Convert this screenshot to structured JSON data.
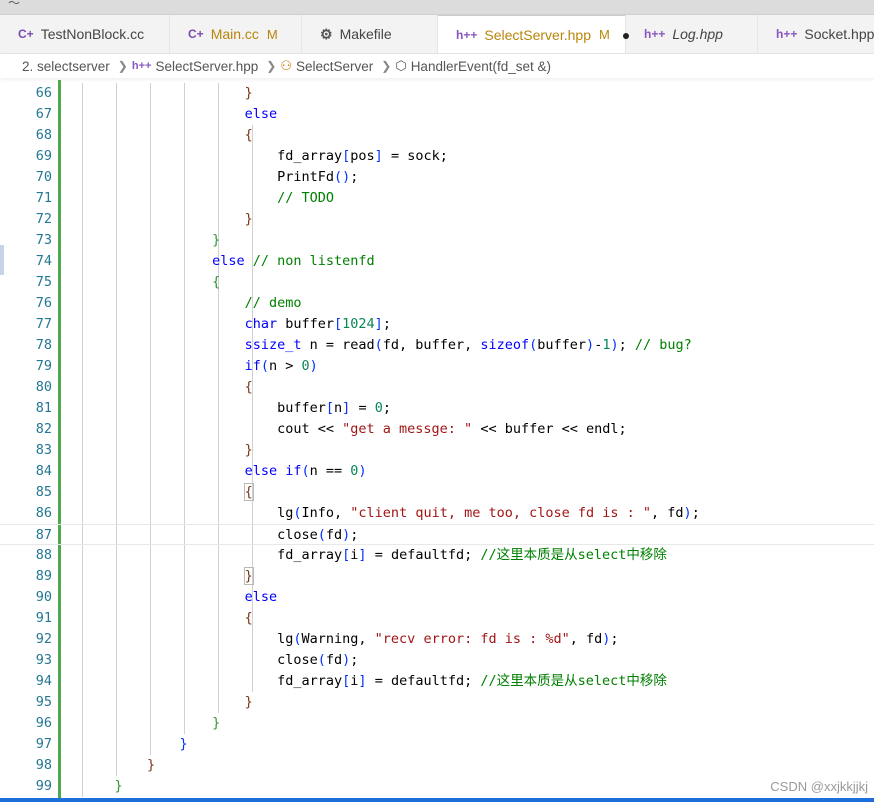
{
  "tabs": [
    {
      "name": "TestNonBlock.cc",
      "icon": "cpp-file-icon",
      "modified": "",
      "active": false
    },
    {
      "name": "Main.cc",
      "icon": "cpp-file-icon",
      "modified": "M",
      "active": false
    },
    {
      "name": "Makefile",
      "icon": "makefile-icon",
      "modified": "",
      "active": false
    },
    {
      "name": "SelectServer.hpp",
      "icon": "hpp-file-icon",
      "modified": "M",
      "active": true,
      "unsaved_dot": "●"
    },
    {
      "name": "Log.hpp",
      "icon": "hpp-file-icon",
      "modified": "",
      "active": false
    },
    {
      "name": "Socket.hpp",
      "icon": "hpp-file-icon",
      "modified": "",
      "active": false
    }
  ],
  "icon_glyphs": {
    "cpp": "C+",
    "hpp": "h++",
    "makefile": "⚙"
  },
  "breadcrumb": {
    "folder": "2. selectserver",
    "file": "SelectServer.hpp",
    "class": "SelectServer",
    "method": "HandlerEvent(fd_set &)"
  },
  "lines": [
    {
      "n": "66",
      "tokens": [
        [
          "brace3",
          "}"
        ]
      ]
    },
    {
      "n": "67",
      "tokens": [
        [
          "kw",
          "else"
        ]
      ]
    },
    {
      "n": "68",
      "tokens": [
        [
          "brace3",
          "{"
        ]
      ]
    },
    {
      "n": "69",
      "tokens": [
        [
          "plain",
          "fd_array"
        ],
        [
          "brk",
          "["
        ],
        [
          "plain",
          "pos"
        ],
        [
          "brk",
          "]"
        ],
        [
          "plain",
          " = sock;"
        ]
      ]
    },
    {
      "n": "70",
      "tokens": [
        [
          "plain",
          "PrintFd"
        ],
        [
          "brk",
          "()"
        ],
        [
          "plain",
          ";"
        ]
      ]
    },
    {
      "n": "71",
      "tokens": [
        [
          "cm",
          "// TODO"
        ]
      ]
    },
    {
      "n": "72",
      "tokens": [
        [
          "brace3",
          "}"
        ]
      ]
    },
    {
      "n": "73",
      "tokens": [
        [
          "brace2",
          "}"
        ]
      ]
    },
    {
      "n": "74",
      "tokens": [
        [
          "kw",
          "else"
        ],
        [
          "plain",
          " "
        ],
        [
          "cm",
          "// non listenfd"
        ]
      ]
    },
    {
      "n": "75",
      "tokens": [
        [
          "brace2",
          "{"
        ]
      ]
    },
    {
      "n": "76",
      "tokens": [
        [
          "cm",
          "// demo"
        ]
      ]
    },
    {
      "n": "77",
      "tokens": [
        [
          "ty2",
          "char"
        ],
        [
          "plain",
          " buffer"
        ],
        [
          "brk",
          "["
        ],
        [
          "num",
          "1024"
        ],
        [
          "brk",
          "]"
        ],
        [
          "plain",
          ";"
        ]
      ]
    },
    {
      "n": "78",
      "tokens": [
        [
          "ty2",
          "ssize_t"
        ],
        [
          "plain",
          " n = read"
        ],
        [
          "brk",
          "("
        ],
        [
          "plain",
          "fd, buffer, "
        ],
        [
          "kw",
          "sizeof"
        ],
        [
          "brk",
          "("
        ],
        [
          "plain",
          "buffer"
        ],
        [
          "brk",
          ")"
        ],
        [
          "plain",
          "-"
        ],
        [
          "num",
          "1"
        ],
        [
          "brk",
          ")"
        ],
        [
          "plain",
          "; "
        ],
        [
          "cm",
          "// bug?"
        ]
      ]
    },
    {
      "n": "79",
      "tokens": [
        [
          "kw",
          "if"
        ],
        [
          "brk",
          "("
        ],
        [
          "plain",
          "n > "
        ],
        [
          "num",
          "0"
        ],
        [
          "brk",
          ")"
        ]
      ]
    },
    {
      "n": "80",
      "tokens": [
        [
          "brace3",
          "{"
        ]
      ]
    },
    {
      "n": "81",
      "tokens": [
        [
          "plain",
          "buffer"
        ],
        [
          "brk",
          "["
        ],
        [
          "plain",
          "n"
        ],
        [
          "brk",
          "]"
        ],
        [
          "plain",
          " = "
        ],
        [
          "num",
          "0"
        ],
        [
          "plain",
          ";"
        ]
      ]
    },
    {
      "n": "82",
      "tokens": [
        [
          "plain",
          "cout << "
        ],
        [
          "str",
          "\"get a messge: \""
        ],
        [
          "plain",
          " << buffer << endl;"
        ]
      ]
    },
    {
      "n": "83",
      "tokens": [
        [
          "brace3",
          "}"
        ]
      ]
    },
    {
      "n": "84",
      "tokens": [
        [
          "kw",
          "else"
        ],
        [
          "plain",
          " "
        ],
        [
          "kw",
          "if"
        ],
        [
          "brk",
          "("
        ],
        [
          "plain",
          "n == "
        ],
        [
          "num",
          "0"
        ],
        [
          "brk",
          ")"
        ]
      ]
    },
    {
      "n": "85",
      "tokens": [
        [
          "brace3h",
          "{"
        ]
      ]
    },
    {
      "n": "86",
      "tokens": [
        [
          "plain",
          "lg"
        ],
        [
          "brk",
          "("
        ],
        [
          "plain",
          "Info, "
        ],
        [
          "str",
          "\"client quit, me too, close fd is : \""
        ],
        [
          "plain",
          ", fd"
        ],
        [
          "brk",
          ")"
        ],
        [
          "plain",
          ";"
        ]
      ]
    },
    {
      "n": "87",
      "tokens": [
        [
          "plain",
          "close"
        ],
        [
          "brk",
          "("
        ],
        [
          "plain",
          "fd"
        ],
        [
          "brk",
          ")"
        ],
        [
          "plain",
          ";"
        ]
      ]
    },
    {
      "n": "88",
      "tokens": [
        [
          "plain",
          "fd_array"
        ],
        [
          "brk",
          "["
        ],
        [
          "plain",
          "i"
        ],
        [
          "brk",
          "]"
        ],
        [
          "plain",
          " = defaultfd; "
        ],
        [
          "cm",
          "//这里本质是从select中移除"
        ]
      ]
    },
    {
      "n": "89",
      "tokens": [
        [
          "brace3h",
          "}"
        ]
      ]
    },
    {
      "n": "90",
      "tokens": [
        [
          "kw",
          "else"
        ]
      ]
    },
    {
      "n": "91",
      "tokens": [
        [
          "brace3",
          "{"
        ]
      ]
    },
    {
      "n": "92",
      "tokens": [
        [
          "plain",
          "lg"
        ],
        [
          "brk",
          "("
        ],
        [
          "plain",
          "Warning, "
        ],
        [
          "str",
          "\"recv error: fd is : %d\""
        ],
        [
          "plain",
          ", fd"
        ],
        [
          "brk",
          ")"
        ],
        [
          "plain",
          ";"
        ]
      ]
    },
    {
      "n": "93",
      "tokens": [
        [
          "plain",
          "close"
        ],
        [
          "brk",
          "("
        ],
        [
          "plain",
          "fd"
        ],
        [
          "brk",
          ")"
        ],
        [
          "plain",
          ";"
        ]
      ]
    },
    {
      "n": "94",
      "tokens": [
        [
          "plain",
          "fd_array"
        ],
        [
          "brk",
          "["
        ],
        [
          "plain",
          "i"
        ],
        [
          "brk",
          "]"
        ],
        [
          "plain",
          " = defaultfd; "
        ],
        [
          "cm",
          "//这里本质是从select中移除"
        ]
      ]
    },
    {
      "n": "95",
      "tokens": [
        [
          "brace3",
          "}"
        ]
      ]
    },
    {
      "n": "96",
      "tokens": [
        [
          "brace2",
          "}"
        ]
      ]
    },
    {
      "n": "97",
      "tokens": [
        [
          "brace1",
          "}"
        ]
      ]
    },
    {
      "n": "98",
      "tokens": [
        [
          "brace3",
          "}"
        ]
      ]
    },
    {
      "n": "99",
      "tokens": [
        [
          "brace2",
          "}"
        ]
      ]
    }
  ],
  "watermark": "CSDN @xxjkkjjkj",
  "colors": {
    "accent": "#1e6fd9",
    "gutter_git": "#4ea84e",
    "line_number": "#237893",
    "modified": "#b8860b"
  }
}
